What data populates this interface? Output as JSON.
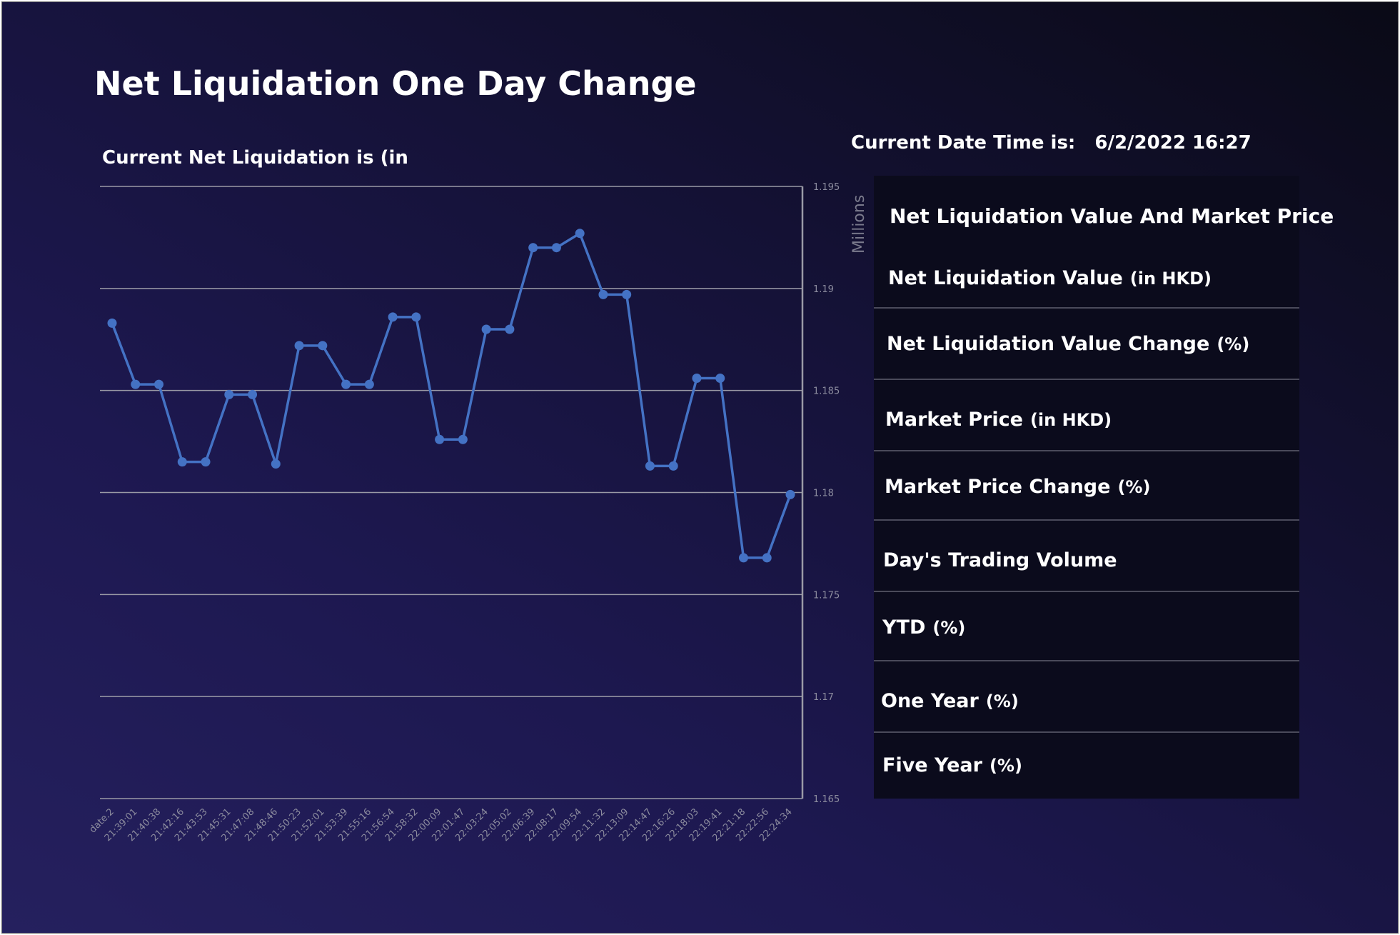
{
  "header": {
    "title": "Net Liquidation One Day Change"
  },
  "chart_data": {
    "type": "line",
    "title": "Current Net Liquidation is (in",
    "xlabel": "",
    "ylabel": "Millions",
    "ylim": [
      1.165,
      1.195
    ],
    "yticks": [
      "1.195",
      "1.19",
      "1.185",
      "1.18",
      "1.175",
      "1.17",
      "1.165"
    ],
    "grid": true,
    "y_axis_side": "right",
    "categories": [
      "date.2",
      "21:39:01",
      "21:40:38",
      "21:42:16",
      "21:43:53",
      "21:45:31",
      "21:47:08",
      "21:48:46",
      "21:50:23",
      "21:52:01",
      "21:53:39",
      "21:55:16",
      "21:56:54",
      "21:58:32",
      "22:00:09",
      "22:01:47",
      "22:03:24",
      "22:05:02",
      "22:06:39",
      "22:08:17",
      "22:09:54",
      "22:11:32",
      "22:13:09",
      "22:14:47",
      "22:16:26",
      "22:18:03",
      "22:19:41",
      "22:21:18",
      "22:22:56",
      "22:24:34"
    ],
    "series": [
      {
        "color": "#4472c4",
        "values": [
          1.1883,
          1.1853,
          1.1853,
          1.1815,
          1.1815,
          1.1848,
          1.1848,
          1.1814,
          1.1872,
          1.1872,
          1.1853,
          1.1853,
          1.1886,
          1.1886,
          1.1826,
          1.1826,
          1.188,
          1.188,
          1.192,
          1.192,
          1.1927,
          1.1897,
          1.1897,
          1.1813,
          1.1813,
          1.1856,
          1.1856,
          1.1768,
          1.1768,
          1.1799
        ]
      }
    ]
  },
  "datetime": {
    "label": "Current Date Time is:",
    "value": "6/2/2022 16:27"
  },
  "metrics": {
    "title": "Net Liquidation Value And Market Price",
    "rows": [
      {
        "label": "Net Liquidation Value",
        "unit": "(in HKD)"
      },
      {
        "label": "Net Liquidation Value Change",
        "unit": "(%)"
      },
      {
        "label": "Market Price",
        "unit": "(in HKD)"
      },
      {
        "label": "Market Price Change",
        "unit": "(%)"
      },
      {
        "label": "Day's Trading Volume",
        "unit": ""
      },
      {
        "label": "YTD",
        "unit": "(%)"
      },
      {
        "label": "One Year",
        "unit": "(%)"
      },
      {
        "label": "Five Year",
        "unit": "(%)"
      }
    ]
  },
  "colors": {
    "line": "#4472c4",
    "gridline": "#9a9aa6",
    "metrics_background": "#0b0b1c",
    "divider": "#4a4a5a"
  }
}
